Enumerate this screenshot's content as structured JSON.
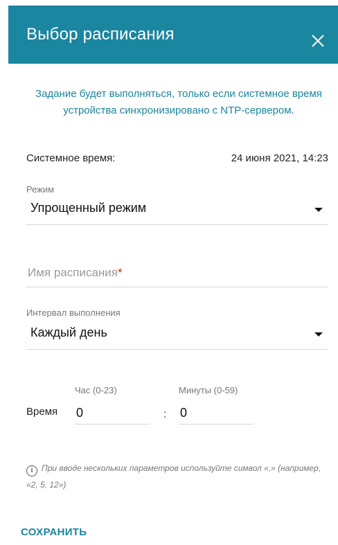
{
  "dialog": {
    "title": "Выбор расписания",
    "notice": "Задание будет выполняться, только если системное время устройства синхронизировано с NTP-сервером."
  },
  "system_time": {
    "label": "Системное время:",
    "value": "24 июня 2021, 14:23"
  },
  "mode": {
    "label": "Режим",
    "value": "Упрощенный режим"
  },
  "schedule_name": {
    "placeholder": "Имя расписания",
    "required_mark": "*"
  },
  "interval": {
    "label": "Интервал выполнения",
    "value": "Каждый день"
  },
  "time": {
    "label": "Время",
    "hour_label": "Час (0-23)",
    "hour_value": "0",
    "separator": ":",
    "minute_label": "Минуты (0-59)",
    "minute_value": "0"
  },
  "hint": {
    "icon": "i",
    "text": "При вводе нескольких параметров используйте символ «,» (например, «2, 5, 12»)"
  },
  "actions": {
    "save_label": "СОХРАНИТЬ"
  },
  "colors": {
    "accent": "#1a86a0",
    "required": "#d0241c"
  },
  "icons": {
    "close": "close-icon",
    "dropdown": "caret-down-icon",
    "info": "info-icon"
  }
}
